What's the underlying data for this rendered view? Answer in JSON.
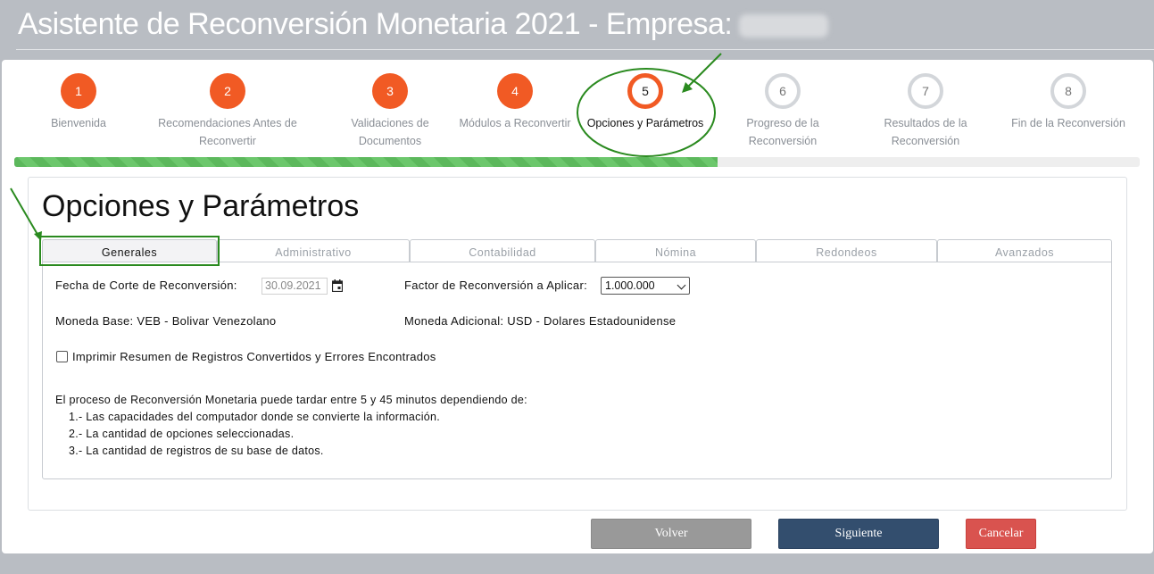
{
  "header": {
    "title": "Asistente de Reconversión Monetaria 2021 - Empresa:"
  },
  "steps": [
    {
      "number": "1",
      "label": "Bienvenida",
      "state": "done"
    },
    {
      "number": "2",
      "label": "Recomendaciones Antes de Reconvertir",
      "state": "done"
    },
    {
      "number": "3",
      "label": "Validaciones de Documentos",
      "state": "done"
    },
    {
      "number": "4",
      "label": "Módulos a Reconvertir",
      "state": "done"
    },
    {
      "number": "5",
      "label": "Opciones y Parámetros",
      "state": "active"
    },
    {
      "number": "6",
      "label": "Progreso de la Reconversión",
      "state": "pending"
    },
    {
      "number": "7",
      "label": "Resultados de la Reconversión",
      "state": "pending"
    },
    {
      "number": "8",
      "label": "Fin de la Reconversión",
      "state": "pending"
    }
  ],
  "progress": {
    "fraction": 0.625
  },
  "section": {
    "title": "Opciones y Parámetros"
  },
  "tabs": [
    {
      "label": "Generales",
      "active": true
    },
    {
      "label": "Administrativo",
      "active": false
    },
    {
      "label": "Contabilidad",
      "active": false
    },
    {
      "label": "Nómina",
      "active": false
    },
    {
      "label": "Redondeos",
      "active": false
    },
    {
      "label": "Avanzados",
      "active": false
    }
  ],
  "form": {
    "cutoff_label": "Fecha de Corte de Reconversión:",
    "cutoff_value": "30.09.2021",
    "factor_label": "Factor de Reconversión a Aplicar:",
    "factor_value": "1.000.000",
    "base_currency": "Moneda Base: VEB - Bolivar Venezolano",
    "additional_currency": "Moneda Adicional: USD - Dolares Estadounidense",
    "print_summary_label": "Imprimir Resumen de Registros Convertidos y Errores Encontrados",
    "print_summary_checked": false
  },
  "info": {
    "intro": "El proceso de Reconversión Monetaria puede tardar entre 5 y 45 minutos dependiendo de:",
    "items": [
      "1.-  Las capacidades del computador donde se convierte la información.",
      "2.-  La cantidad de opciones seleccionadas.",
      "3.-  La cantidad de registros de su base de datos."
    ]
  },
  "buttons": {
    "back": "Volver",
    "next": "Siguiente",
    "cancel": "Cancelar"
  },
  "colors": {
    "accent": "#f15a24",
    "progress": "#5cb85c",
    "primary_button": "#334e6e",
    "danger_button": "#d9534f",
    "annotation": "#2a8a1f"
  }
}
